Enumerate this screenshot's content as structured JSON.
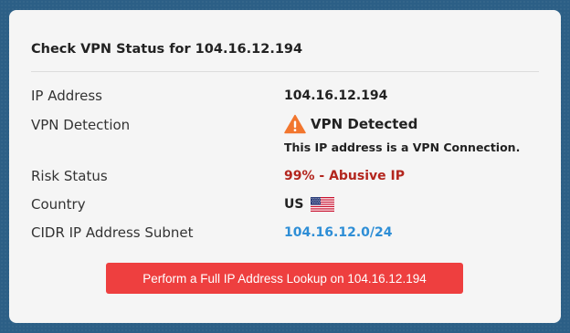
{
  "card": {
    "title": "Check VPN Status for 104.16.12.194"
  },
  "rows": {
    "ip": {
      "label": "IP Address",
      "value": "104.16.12.194"
    },
    "vpn": {
      "label": "VPN Detection",
      "value": "VPN Detected",
      "description": "This IP address is a VPN Connection.",
      "icon": "warning-icon"
    },
    "risk": {
      "label": "Risk Status",
      "value": "99% - Abusive IP",
      "color": "#b3261e"
    },
    "country": {
      "label": "Country",
      "value": "US",
      "icon": "us-flag-icon"
    },
    "cidr": {
      "label": "CIDR IP Address Subnet",
      "value": "104.16.12.0/24",
      "color": "#2e8ed6"
    }
  },
  "action": {
    "lookup_label": "Perform a Full IP Address Lookup on 104.16.12.194",
    "color": "#ee3f3f"
  }
}
